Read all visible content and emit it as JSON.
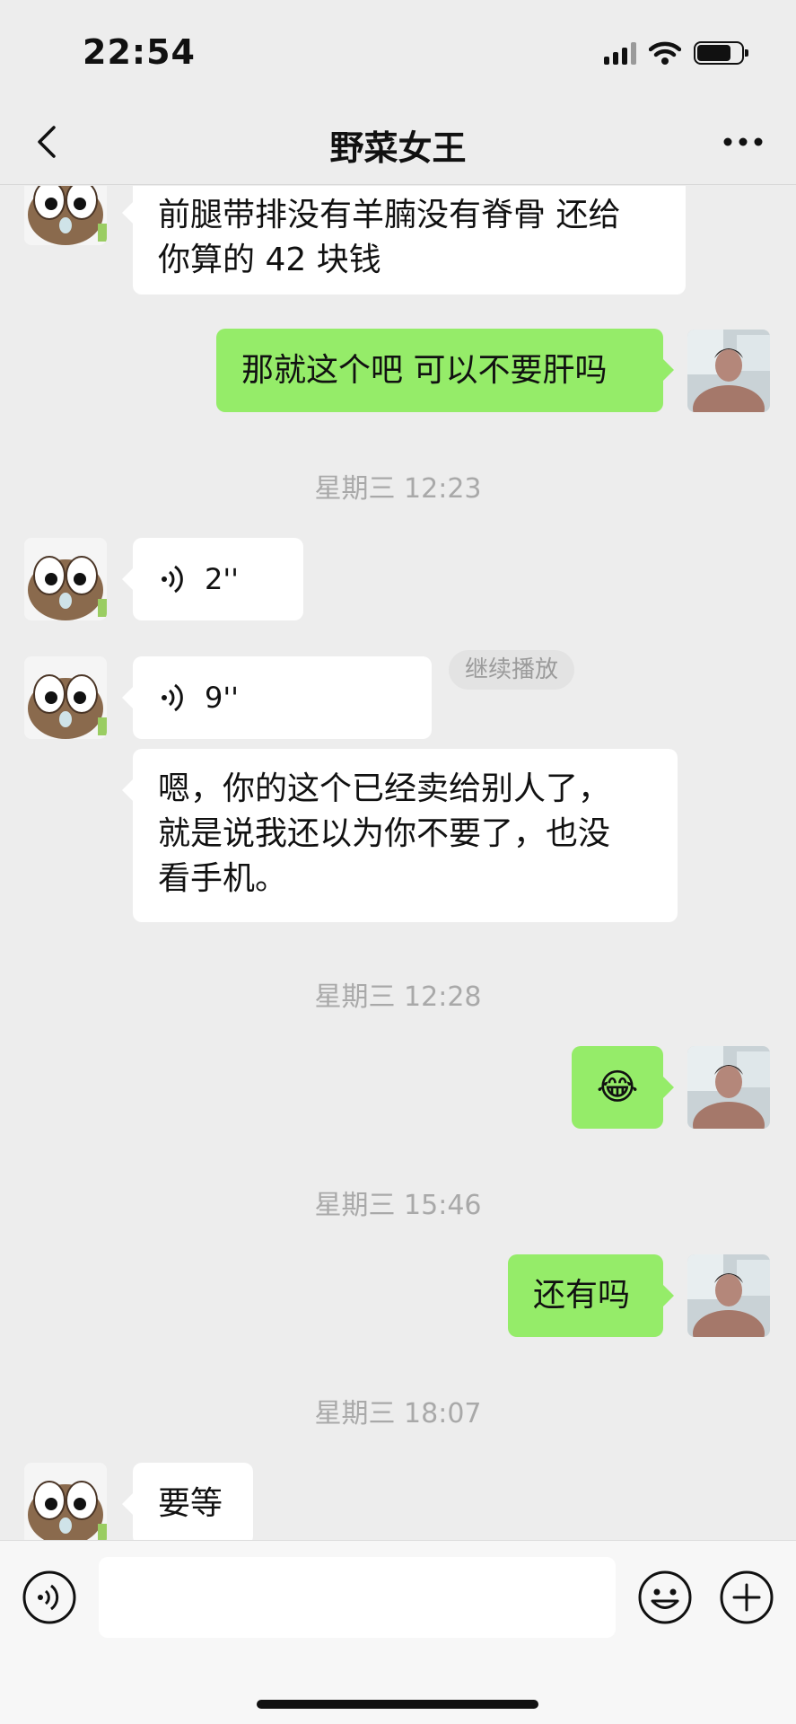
{
  "status_bar": {
    "time": "22:54"
  },
  "nav": {
    "title": "野菜女王"
  },
  "messages": {
    "m1_line1": "前腿带排没有羊腩没有脊骨 还给",
    "m1_line2": "你算的 42 块钱",
    "m2": "那就这个吧 可以不要肝吗",
    "ts1": "星期三 12:23",
    "voice1": "2''",
    "voice2": "9''",
    "continue_label": "继续播放",
    "m3_line1": "嗯，你的这个已经卖给别人了，",
    "m3_line2": "就是说我还以为你不要了，也没",
    "m3_line3": "看手机。",
    "ts2": "星期三 12:28",
    "m4_emoji": "😂",
    "ts3": "星期三 15:46",
    "m5": "还有吗",
    "ts4": "星期三 18:07",
    "m6": "要等"
  },
  "colors": {
    "background": "#ededed",
    "sent_bubble": "#95ec69",
    "received_bubble": "#ffffff",
    "timestamp": "#a9a9a9"
  },
  "icons": {
    "back": "chevron-left-icon",
    "more": "more-dots-icon",
    "voice": "voice-wave-icon",
    "voice_input": "voice-input-icon",
    "emoji": "emoji-face-icon",
    "plus": "plus-circle-icon"
  }
}
